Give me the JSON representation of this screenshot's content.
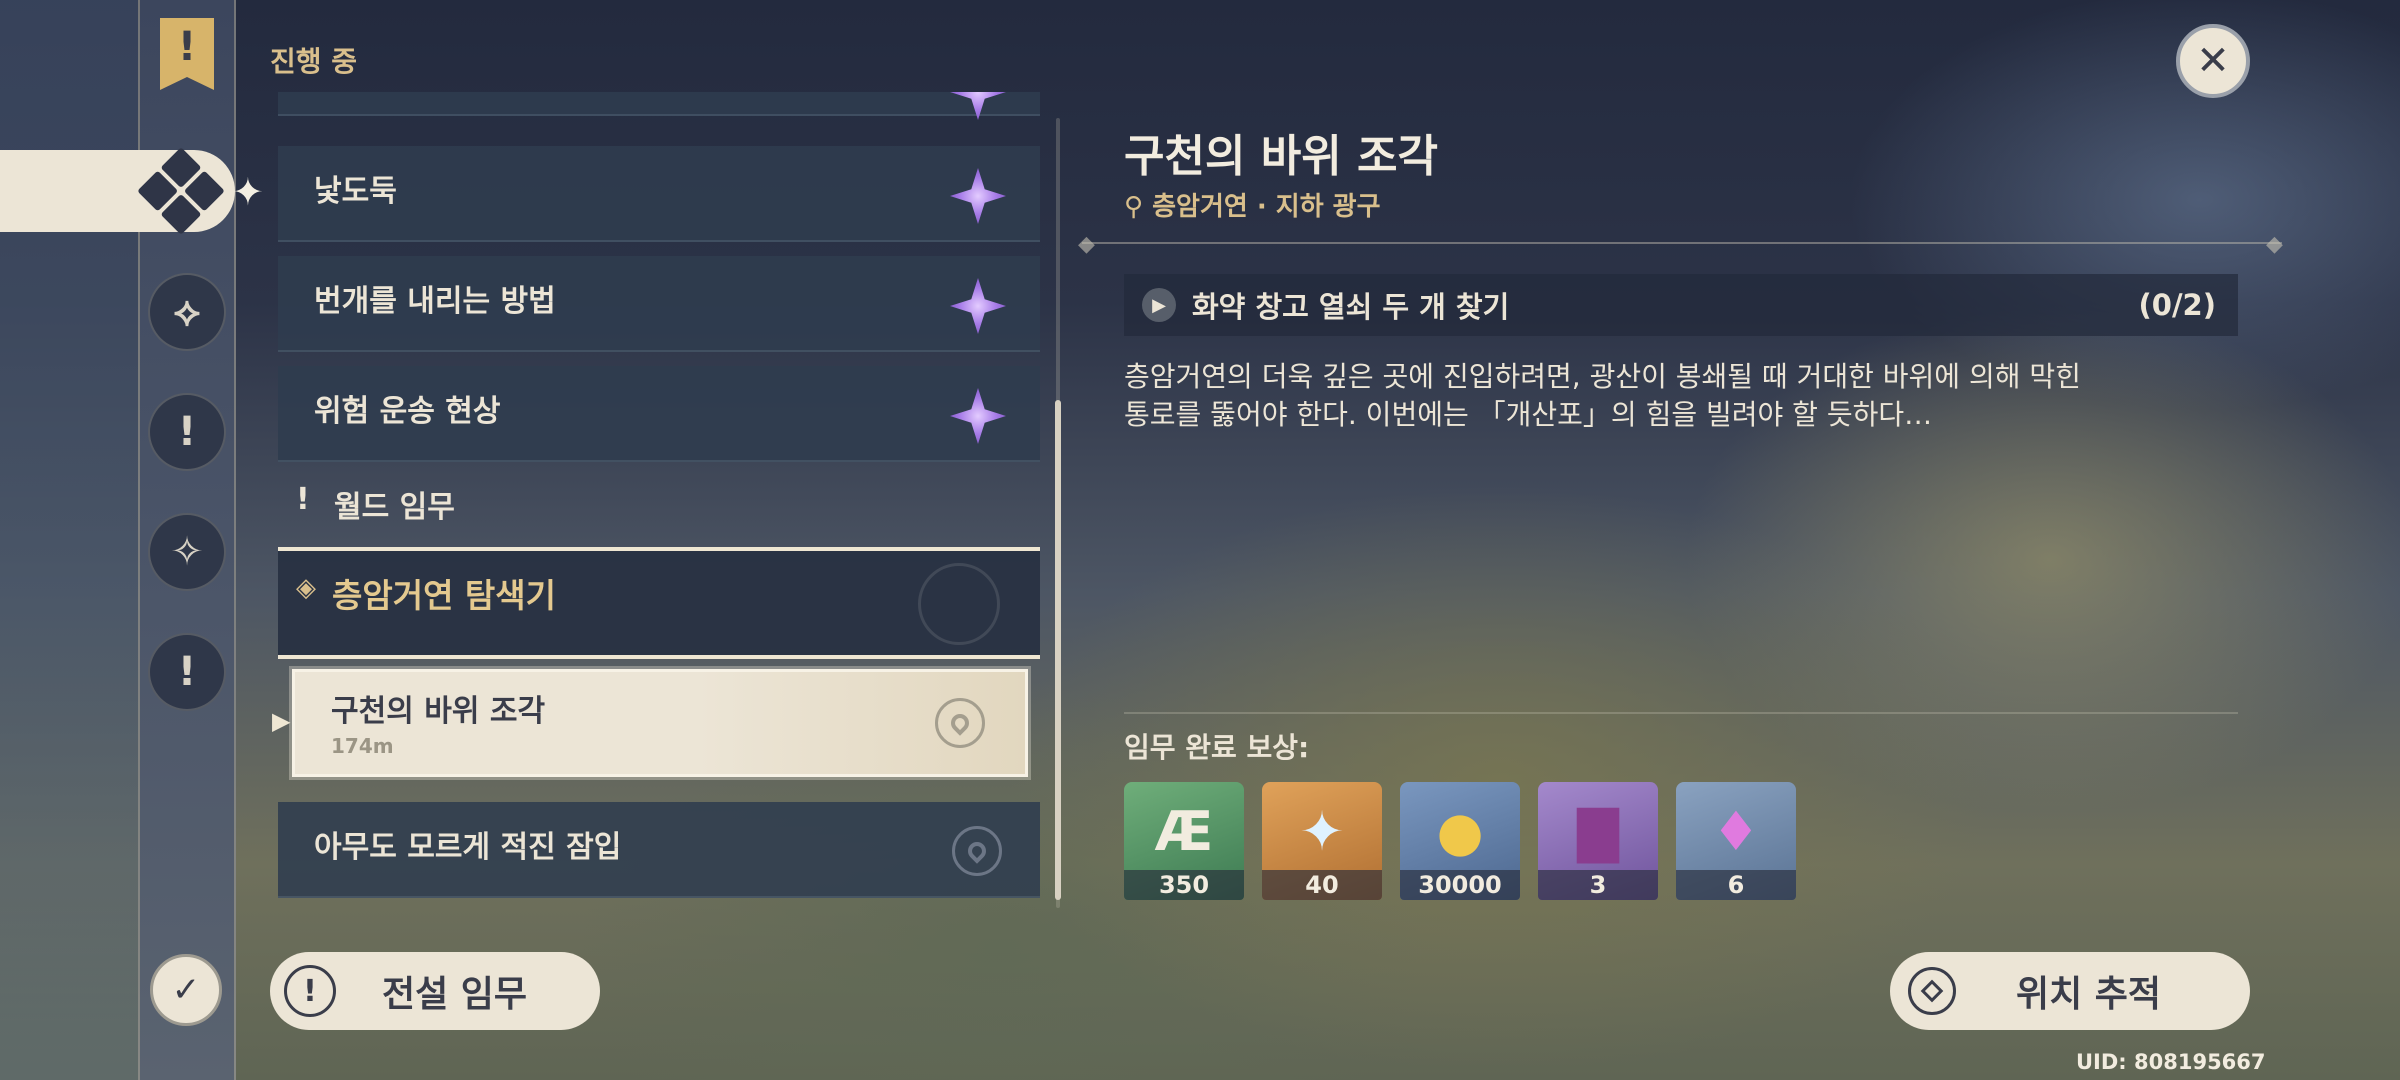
{
  "sidebar": {
    "icons": [
      "banner-exclamation-icon",
      "quest-category-icon",
      "archon-quest-icon",
      "story-quest-icon",
      "world-quest-icon",
      "event-quest-icon",
      "daily-commission-icon"
    ]
  },
  "quest_list": {
    "category_title": "진행 중",
    "items": [
      {
        "label": "낯도둑",
        "icon": "purple-star-icon"
      },
      {
        "label": "번개를 내리는 방법",
        "icon": "purple-star-icon"
      },
      {
        "label": "위험 운송 현상",
        "icon": "purple-star-icon"
      }
    ],
    "world_header": "월드 임무",
    "group": {
      "label": "층암거연 탐색기"
    },
    "active_sub": {
      "label": "구천의 바위 조각",
      "distance": "174m"
    },
    "next_sub": {
      "label": "아무도 모르게 적진 잠입"
    }
  },
  "legend_button": {
    "label": "전설 임무"
  },
  "detail": {
    "title": "구천의 바위 조각",
    "location": "층암거연 · 지하 광구",
    "objective": {
      "text": "화약 창고 열쇠 두 개 찾기",
      "progress": "(0/2)"
    },
    "description_lines": [
      "층암거연의 더욱 깊은 곳에 진입하려면, 광산이 봉쇄될 때 거대한 바위에 의해 막힌",
      "통로를 뚫어야 한다. 이번에는 「개산포」의 힘을 빌려야 할 듯하다…"
    ],
    "reward_label": "임무 완료 보상:",
    "rewards": [
      {
        "name": "adventure-exp-icon",
        "count": "350",
        "color": "#4f8f63"
      },
      {
        "name": "primogem-icon",
        "count": "40",
        "color": "#c98a46"
      },
      {
        "name": "mora-icon",
        "count": "30000",
        "color": "#5f7fa8"
      },
      {
        "name": "heros-wit-icon",
        "count": "3",
        "color": "#8b6fb4"
      },
      {
        "name": "enhancement-ore-icon",
        "count": "6",
        "color": "#6f88a8"
      }
    ]
  },
  "track_button": {
    "label": "위치 추적"
  },
  "uid": "UID: 808195667"
}
